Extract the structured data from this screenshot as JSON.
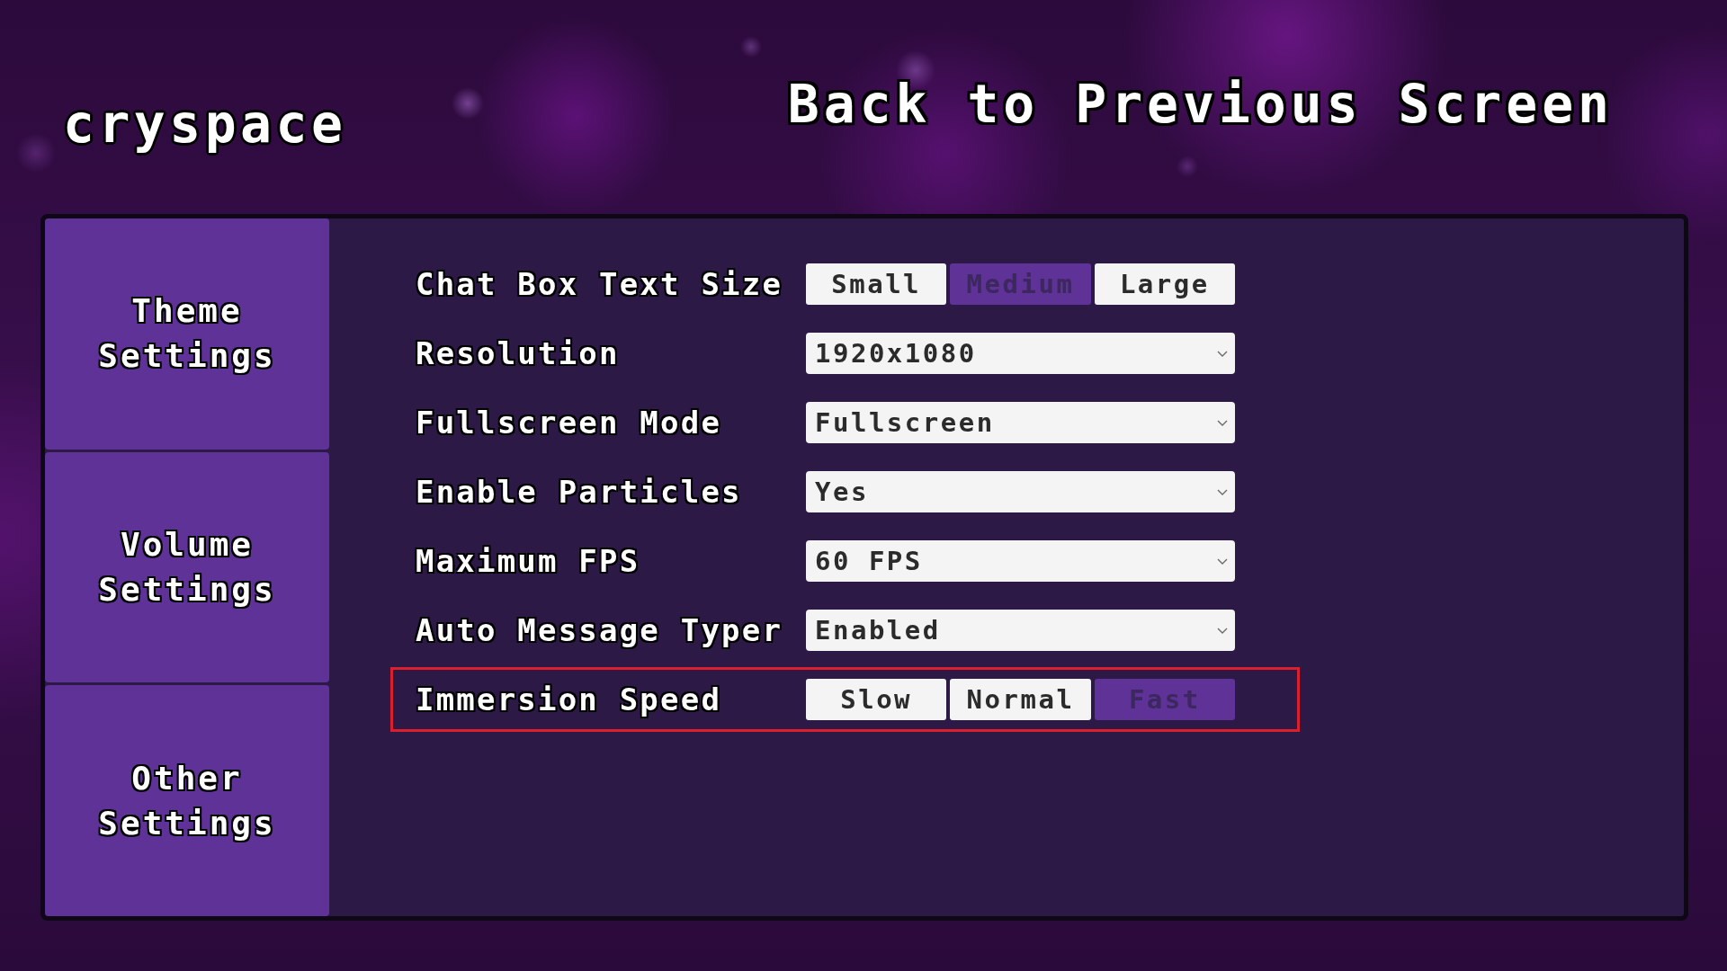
{
  "app_title": "cryspace",
  "back_link": "Back to Previous Screen",
  "sidebar": {
    "items": [
      {
        "label": "Theme Settings"
      },
      {
        "label": "Volume Settings"
      },
      {
        "label": "Other Settings"
      }
    ]
  },
  "settings": [
    {
      "kind": "segmented",
      "label": "Chat Box Text Size",
      "highlighted": false,
      "options": [
        {
          "label": "Small",
          "selected": false
        },
        {
          "label": "Medium",
          "selected": true
        },
        {
          "label": "Large",
          "selected": false
        }
      ]
    },
    {
      "kind": "dropdown",
      "label": "Resolution",
      "highlighted": false,
      "value": "1920x1080"
    },
    {
      "kind": "dropdown",
      "label": "Fullscreen Mode",
      "highlighted": false,
      "value": "Fullscreen"
    },
    {
      "kind": "dropdown",
      "label": "Enable Particles",
      "highlighted": false,
      "value": "Yes"
    },
    {
      "kind": "dropdown",
      "label": "Maximum FPS",
      "highlighted": false,
      "value": "60 FPS"
    },
    {
      "kind": "dropdown",
      "label": "Auto Message Typer",
      "highlighted": false,
      "value": "Enabled"
    },
    {
      "kind": "segmented",
      "label": "Immersion Speed",
      "highlighted": true,
      "options": [
        {
          "label": "Slow",
          "selected": false
        },
        {
          "label": "Normal",
          "selected": false
        },
        {
          "label": "Fast",
          "selected": true
        }
      ]
    }
  ]
}
